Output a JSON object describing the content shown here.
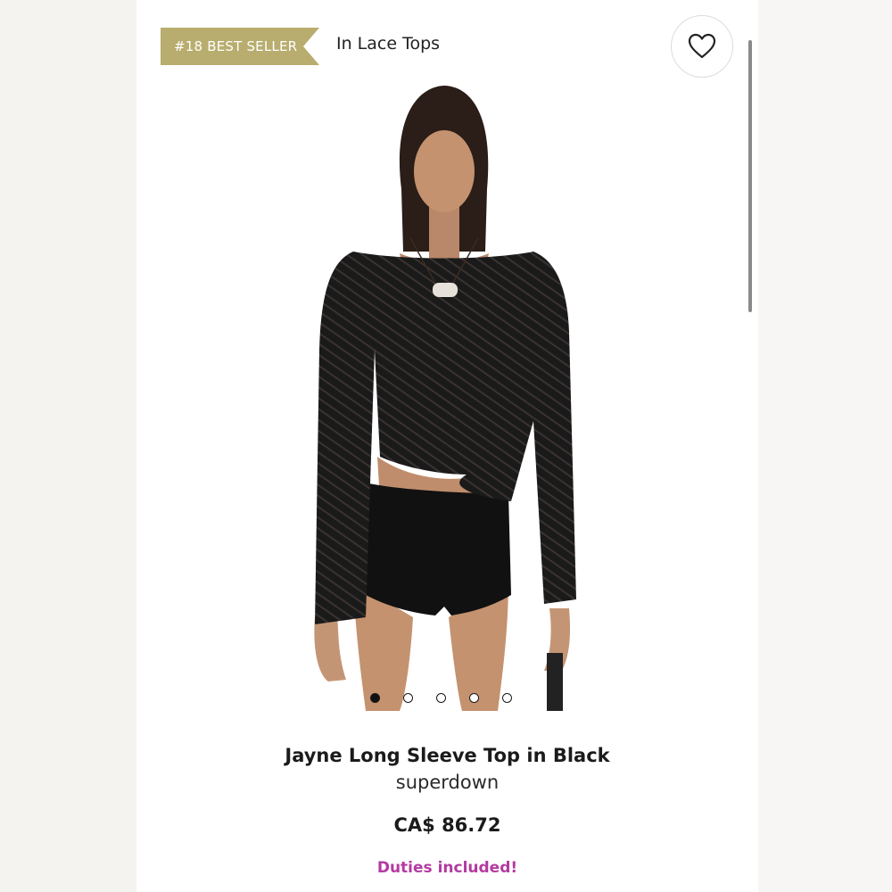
{
  "badge": {
    "label": "#18 BEST SELLER",
    "color": "#b8ad6e"
  },
  "category": "In Lace Tops",
  "favorite_icon": "heart-icon",
  "carousel": {
    "count": 5,
    "active": 0
  },
  "product": {
    "title": "Jayne Long Sleeve Top in Black",
    "brand": "superdown",
    "price": "CA$ 86.72",
    "duties": "Duties included!"
  },
  "colors": {
    "accent": "#b33aa0"
  }
}
